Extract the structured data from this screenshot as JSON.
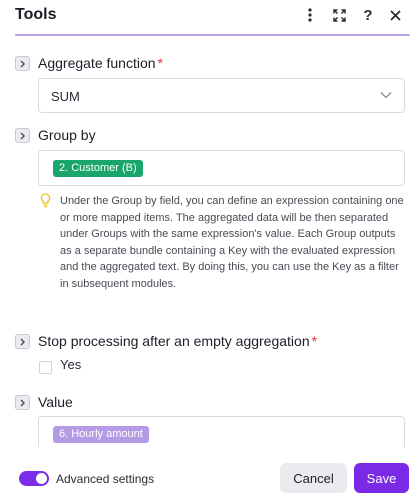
{
  "header": {
    "title": "Tools",
    "icons": [
      "more-vertical-icon",
      "expand-icon",
      "help-icon",
      "close-icon"
    ],
    "help_glyph": "?",
    "close_glyph": "✕"
  },
  "fields": {
    "aggregate_function": {
      "label": "Aggregate function",
      "required_mark": "*",
      "value": "SUM"
    },
    "group_by": {
      "label": "Group by",
      "pill": "2. Customer (B)",
      "hint": "Under the Group by field, you can define an expression containing one or more mapped items. The aggregated data will be then separated under Groups with the same expression's value. Each Group outputs as a separate bundle containing a Key with the evaluated expression and the aggregated text. By doing this, you can use the Key as a filter in subsequent modules."
    },
    "stop_processing": {
      "label": "Stop processing after an empty aggregation",
      "required_mark": "*",
      "checkbox_label": "Yes",
      "checked": false
    },
    "value": {
      "label": "Value",
      "pill": "6. Hourly amount"
    }
  },
  "footer": {
    "advanced_label": "Advanced settings",
    "advanced_enabled": true,
    "cancel_label": "Cancel",
    "save_label": "Save"
  },
  "colors": {
    "accent": "#7a2ae6",
    "pill_green": "#1aa56a",
    "pill_purple": "#b49be6",
    "required": "#e0353b",
    "hint_bulb": "#e8c428"
  }
}
